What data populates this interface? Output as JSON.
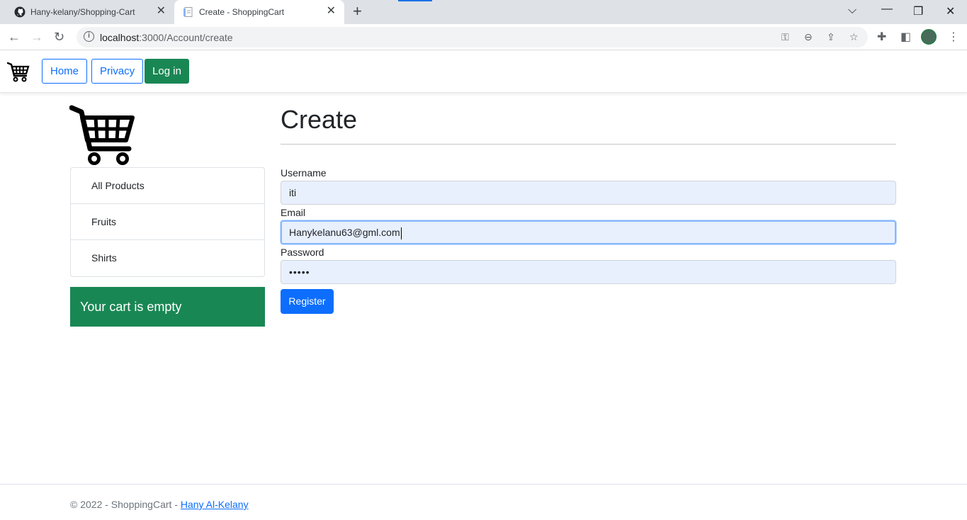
{
  "browser": {
    "tabs": [
      {
        "title": "Hany-kelany/Shopping-Cart",
        "favicon": "github-icon"
      },
      {
        "title": "Create - ShoppingCart",
        "favicon": "page-icon",
        "active": true
      }
    ],
    "url_host": "localhost",
    "url_rest": ":3000/Account/create"
  },
  "navbar": {
    "home": "Home",
    "privacy": "Privacy",
    "login": "Log in"
  },
  "sidebar": {
    "items": [
      {
        "label": "All Products"
      },
      {
        "label": "Fruits"
      },
      {
        "label": "Shirts"
      }
    ],
    "cart_status": "Your cart is empty"
  },
  "form": {
    "title": "Create",
    "username_label": "Username",
    "username_value": "iti",
    "email_label": "Email",
    "email_value": "Hanykelanu63@gml.com",
    "password_label": "Password",
    "password_value": "•••••",
    "submit": "Register"
  },
  "footer": {
    "text": "© 2022 - ShoppingCart - ",
    "link": "Hany Al-Kelany"
  },
  "colors": {
    "primary": "#0d6efd",
    "success": "#198754",
    "autofill": "#e8f0fe"
  }
}
